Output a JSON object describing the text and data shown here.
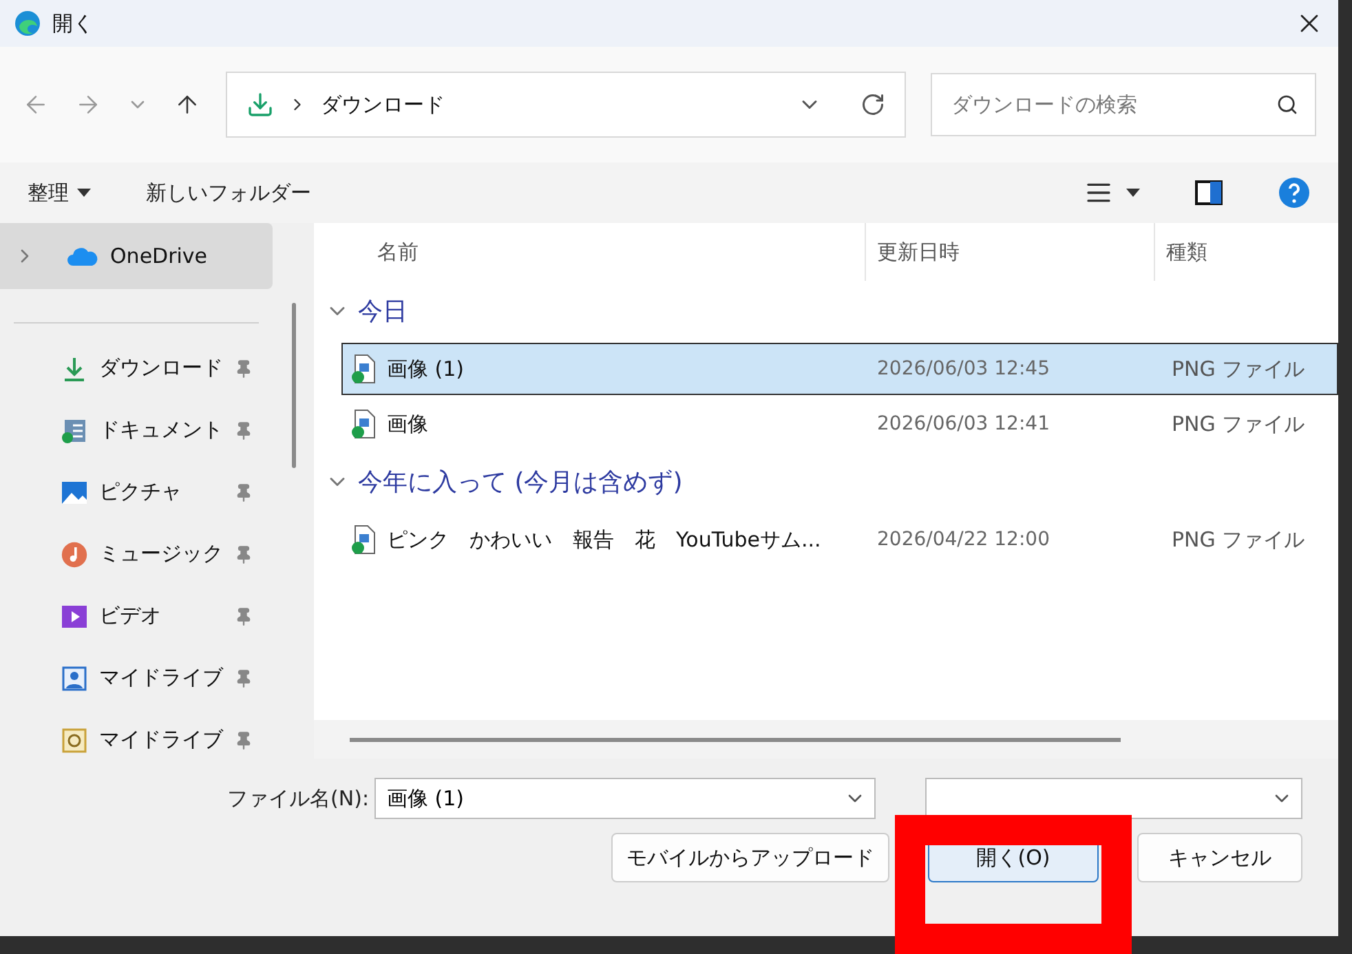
{
  "window": {
    "title": "開く"
  },
  "address": {
    "location": "ダウンロード"
  },
  "search": {
    "placeholder": "ダウンロードの検索"
  },
  "toolbar": {
    "organize": "整理",
    "new_folder": "新しいフォルダー"
  },
  "sidebar": {
    "items": [
      {
        "label": "OneDrive",
        "kind": "cloud",
        "pinned": false,
        "selected": true
      },
      {
        "label": "ダウンロード",
        "kind": "downloads",
        "pinned": true,
        "selected": false
      },
      {
        "label": "ドキュメント",
        "kind": "documents",
        "pinned": true,
        "selected": false
      },
      {
        "label": "ピクチャ",
        "kind": "pictures",
        "pinned": true,
        "selected": false
      },
      {
        "label": "ミュージック",
        "kind": "music",
        "pinned": true,
        "selected": false
      },
      {
        "label": "ビデオ",
        "kind": "videos",
        "pinned": true,
        "selected": false
      },
      {
        "label": "マイドライブ",
        "kind": "drive",
        "pinned": true,
        "selected": false
      },
      {
        "label": "マイドライブ",
        "kind": "drive-alt",
        "pinned": true,
        "selected": false
      }
    ]
  },
  "columns": [
    "名前",
    "更新日時",
    "種類"
  ],
  "groups": [
    {
      "label": "今日",
      "expanded": true,
      "files": [
        {
          "name": "画像 (1)",
          "modified": "2026/06/03 12:45",
          "type": "PNG ファイル",
          "selected": true
        },
        {
          "name": "画像",
          "modified": "2026/06/03 12:41",
          "type": "PNG ファイル",
          "selected": false
        }
      ]
    },
    {
      "label": "今年に入って (今月は含めず)",
      "expanded": true,
      "files": [
        {
          "name": "ピンク　かわいい　報告　花　YouTubeサム...",
          "modified": "2026/04/22 12:00",
          "type": "PNG ファイル",
          "selected": false
        }
      ]
    }
  ],
  "file_name": {
    "label": "ファイル名(N):",
    "value": "画像 (1)"
  },
  "buttons": [
    {
      "label": "モバイルからアップロード",
      "kind": "secondary"
    },
    {
      "label": "開く(O)",
      "kind": "primary"
    },
    {
      "label": "キャンセル",
      "kind": "secondary"
    }
  ]
}
